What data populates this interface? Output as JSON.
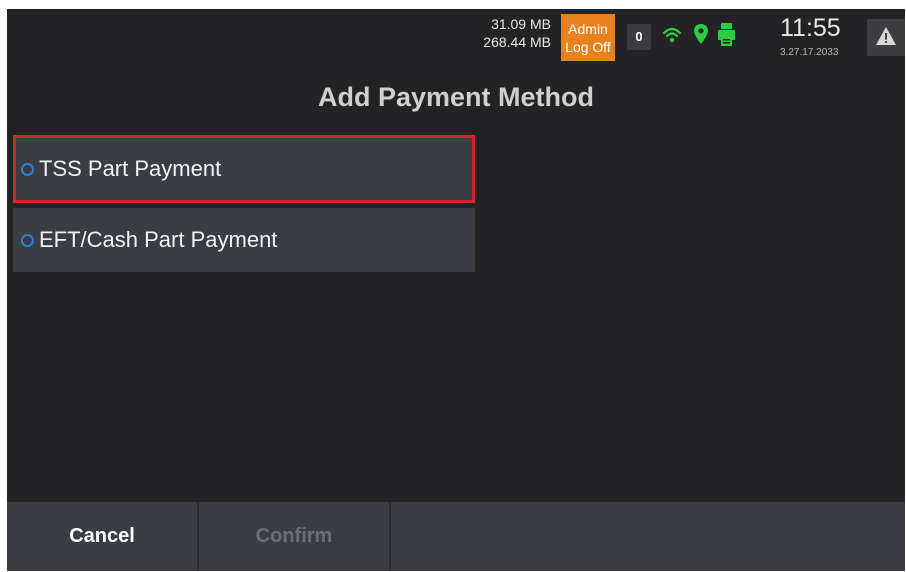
{
  "status_bar": {
    "memory_used": "31.09 MB",
    "memory_total": "268.44 MB",
    "admin_line1": "Admin",
    "admin_line2": "Log Off",
    "queue_count": "0",
    "time": "11:55",
    "version": "3.27.17.2033",
    "icons": [
      "wifi-icon",
      "location-icon",
      "printer-icon",
      "warning-icon"
    ]
  },
  "page": {
    "title": "Add Payment Method"
  },
  "options": [
    {
      "label": "TSS Part Payment",
      "selected": true
    },
    {
      "label": "EFT/Cash Part Payment",
      "selected": false
    }
  ],
  "footer": {
    "cancel_label": "Cancel",
    "confirm_label": "Confirm"
  },
  "colors": {
    "background": "#232325",
    "panel": "#3a3d44",
    "admin_accent": "#e8821e",
    "status_green": "#2ecc40",
    "selection_border": "#d1262c",
    "radio_blue": "#2f7fd6"
  }
}
